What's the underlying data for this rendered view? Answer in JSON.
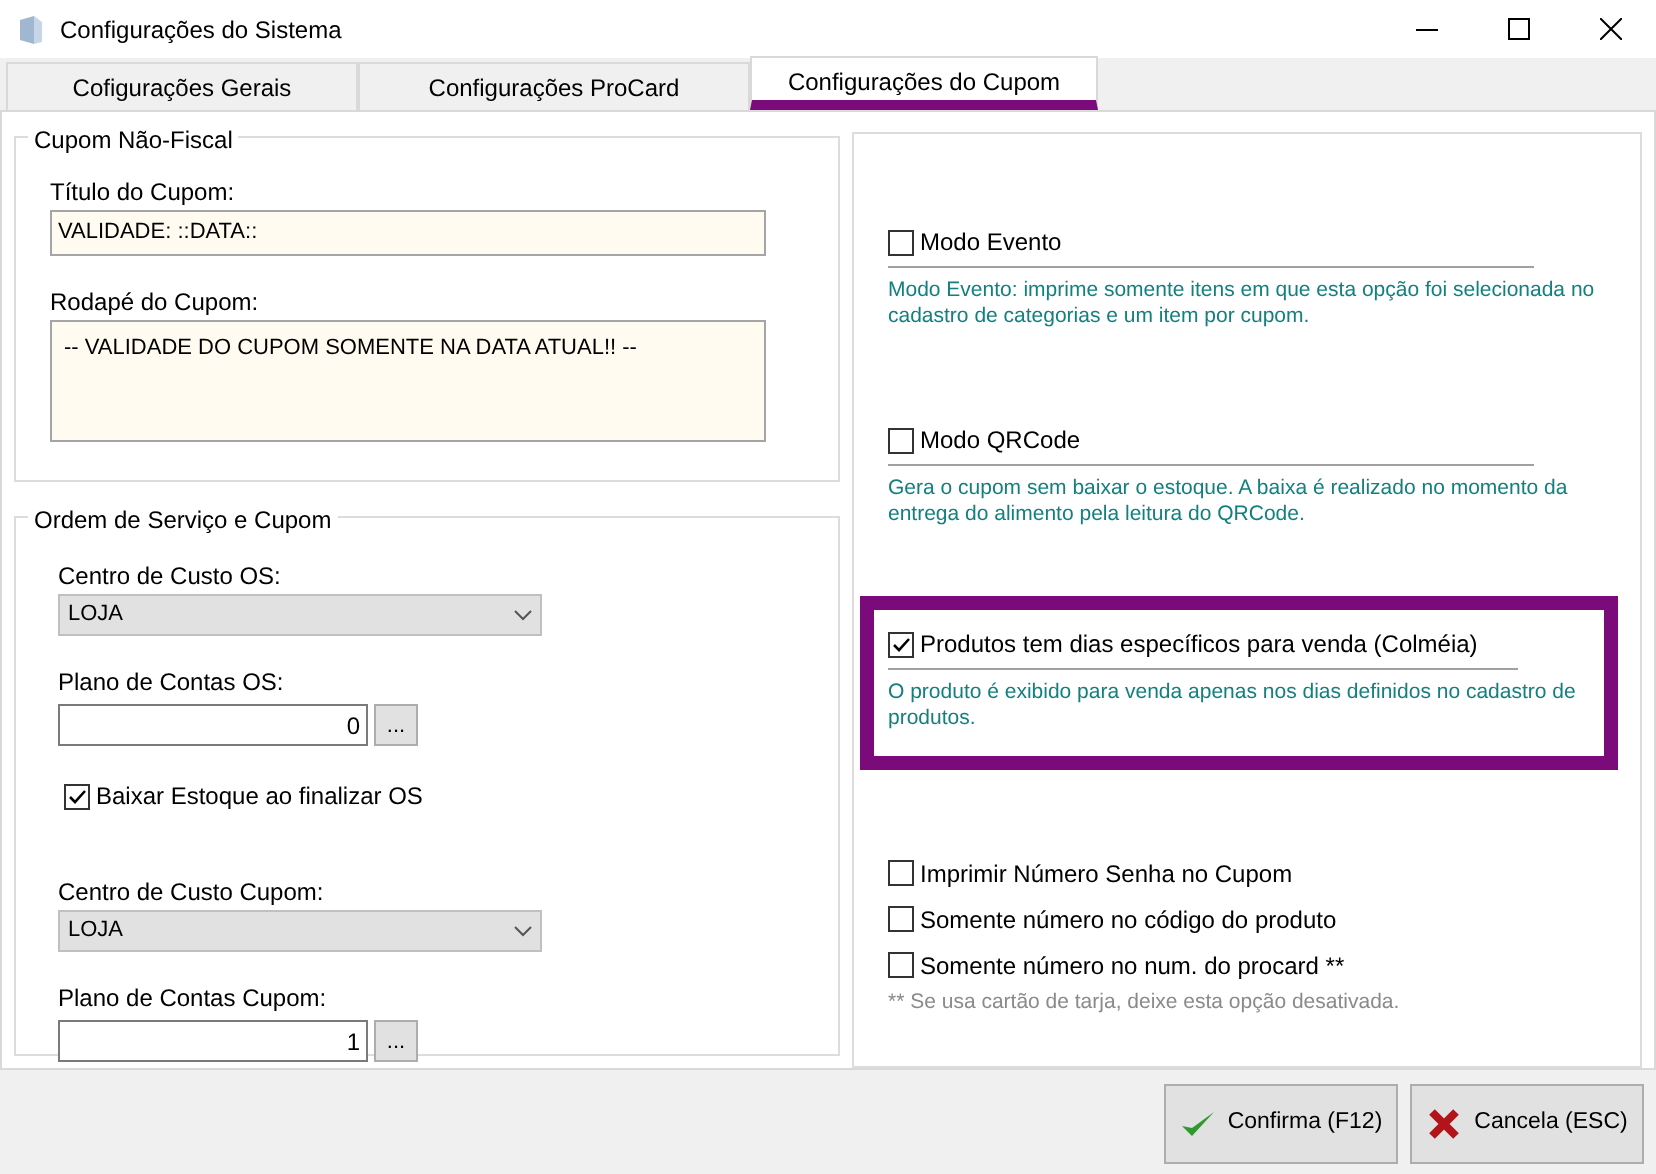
{
  "window": {
    "title": "Configurações do Sistema"
  },
  "tabs": [
    {
      "label": "Cofigurações Gerais",
      "selected": false
    },
    {
      "label": "Configurações ProCard",
      "selected": false
    },
    {
      "label": "Configurações do Cupom",
      "selected": true
    }
  ],
  "cupom_nao_fiscal": {
    "legend": "Cupom Não-Fiscal",
    "fields": [
      {
        "kind": "text",
        "label": "Título do Cupom:",
        "value": "VALIDADE: ::DATA::"
      },
      {
        "kind": "memo",
        "label": "Rodapé do Cupom:",
        "value": "--  VALIDADE DO CUPOM SOMENTE NA DATA ATUAL!!  --"
      }
    ]
  },
  "ordem_servico": {
    "legend": "Ordem de Serviço e Cupom",
    "items": [
      {
        "kind": "select",
        "label": "Centro de Custo OS:",
        "value": "LOJA"
      },
      {
        "kind": "lookup",
        "label": "Plano de Contas OS:",
        "value": "0",
        "button": "..."
      },
      {
        "kind": "checkbox",
        "label": "Baixar Estoque ao finalizar OS",
        "checked": true
      },
      {
        "kind": "select",
        "label": "Centro de Custo Cupom:",
        "value": "LOJA"
      },
      {
        "kind": "lookup",
        "label": "Plano de Contas Cupom:",
        "value": "1",
        "button": "..."
      }
    ]
  },
  "options": [
    {
      "label": "Modo Evento",
      "checked": false,
      "highlighted": false,
      "description": "Modo Evento: imprime somente itens em que esta opção foi selecionada no cadastro de categorias e um item por cupom."
    },
    {
      "label": "Modo QRCode",
      "checked": false,
      "highlighted": false,
      "description": "Gera o cupom sem baixar o estoque. A baixa é realizado no momento da entrega do alimento pela leitura do QRCode."
    },
    {
      "label": "Produtos tem dias específicos para venda (Colméia)",
      "checked": true,
      "highlighted": true,
      "description": "O produto é exibido para venda apenas nos dias definidos no cadastro de produtos."
    }
  ],
  "extra_options": [
    {
      "label": "Imprimir Número Senha no Cupom",
      "checked": false
    },
    {
      "label": "Somente número no código do produto",
      "checked": false
    },
    {
      "label": "Somente número no num. do procard **",
      "checked": false
    }
  ],
  "footnote": "** Se usa cartão de tarja, deixe esta opção desativada.",
  "buttons": [
    {
      "kind": "confirm",
      "label": "Confirma (F12)"
    },
    {
      "kind": "cancel",
      "label": "Cancela (ESC)"
    }
  ]
}
